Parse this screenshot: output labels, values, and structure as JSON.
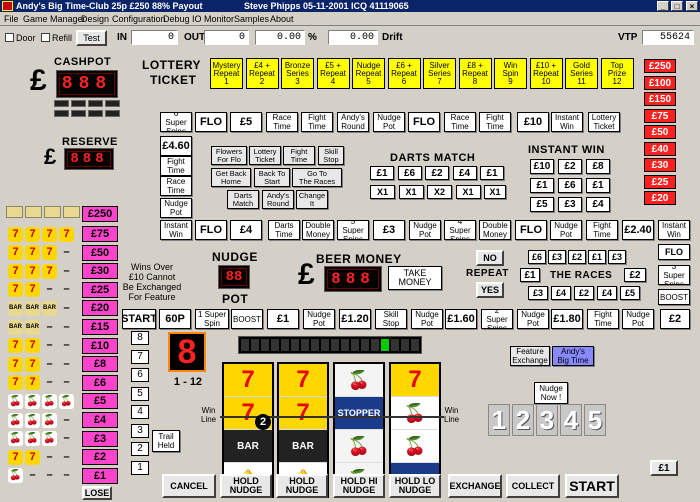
{
  "window": {
    "title": "Andy's Big Time-Club 25p £250 88% Payout",
    "titlebar_right": "Steve Phipps 05-11-2001 ICQ 41119065"
  },
  "menu": [
    "File",
    "Game Manager",
    "Design",
    "Configuration",
    "Debug",
    "IO Monitor",
    "Samples",
    "About"
  ],
  "toolbar": {
    "door_label": "Door",
    "refill_label": "Refill",
    "test_label": "Test",
    "in_label": "IN",
    "in_value": "0",
    "out_label": "OUT",
    "out_value": "0",
    "pct_value": "0.00",
    "pct_sign": "%",
    "drift_value": "0.00",
    "drift_label": "Drift",
    "vtp_label": "VTP",
    "vtp_value": "55624"
  },
  "cashpot": {
    "label": "CASHPOT",
    "currency": "£",
    "digits": "888"
  },
  "reserve": {
    "label": "RESERVE",
    "currency": "£",
    "digits": "888"
  },
  "lottery": {
    "title_line1": "LOTTERY",
    "title_line2": "TICKET",
    "tiles": [
      "Mystery\nRepeat\n1",
      "£4 +\nRepeat\n2",
      "Bronze\nSeries\n3",
      "£5 +\nRepeat\n4",
      "Nudge\nRepeat\n5",
      "£6 +\nRepeat\n6",
      "Silver\nSeries\n7",
      "£8 +\nRepeat\n8",
      "Win\nSpin\n9",
      "£10 +\nRepeat\n10",
      "Gold\nSeries\n11",
      "Top\nPrize\n12"
    ]
  },
  "right_ladder": [
    "£250",
    "£100",
    "£150",
    "£75",
    "£50",
    "£40",
    "£30",
    "£25",
    "£20"
  ],
  "left_ladder": [
    "£250",
    "£75",
    "£50",
    "£30",
    "£25",
    "£20",
    "£15",
    "£10",
    "£8",
    "£6",
    "£5",
    "£4",
    "£3",
    "£2",
    "£1"
  ],
  "lose_label": "LOSE",
  "trail_row1": [
    "6 Super\nSpins",
    "FLO",
    "£5",
    "Race\nTime",
    "Fight\nTime",
    "Andy's\nRound",
    "Nudge\nPot",
    "FLO",
    "Race\nTime",
    "Fight\nTime",
    "£10",
    "Instant\nWin",
    "Lottery\nTicket"
  ],
  "trail_left_col": [
    "£4.60",
    "Fight\nTime",
    "Race\nTime",
    "Nudge\nPot"
  ],
  "mini_grid": [
    "Flowers\nFor Flo",
    "Lottery\nTicket",
    "Fight\nTime",
    "Skill\nStop",
    "Get Back\nHome",
    "Back To\nStart",
    "Go To\nThe Races",
    "Darts\nMatch",
    "Andy's\nRound",
    "Change\nIt"
  ],
  "darts": {
    "label": "DARTS MATCH",
    "row1": [
      "£1",
      "£6",
      "£2",
      "£4",
      "£1"
    ],
    "row2": [
      "X1",
      "X1",
      "X2",
      "X1"
    ]
  },
  "instant_win": {
    "label": "INSTANT WIN",
    "row1": [
      "£10",
      "£2",
      "£8"
    ],
    "row2": [
      "£1",
      "£6",
      "£1"
    ],
    "row3": [
      "£5",
      "£3",
      "£4"
    ]
  },
  "trail_row2": [
    "Instant\nWin",
    "FLO",
    "£4",
    "Darts\nTime",
    "Double\nMoney",
    "5 Super\nSpins",
    "£3",
    "Nudge\nPot",
    "4 Super\nSpins",
    "Double\nMoney",
    "FLO",
    "Nudge\nPot",
    "Fight\nTime",
    "£2.40",
    "Instant\nWin"
  ],
  "right_col": [
    "FLO",
    "3 Super\nSpins",
    "BOOST"
  ],
  "wins_note": "Wins Over\n£10 Cannot\nBe Exchanged\nFor Feature",
  "nudge_pot": {
    "label_top": "NUDGE",
    "label_bottom": "POT",
    "digits": "88"
  },
  "beer_money": {
    "label": "BEER MONEY",
    "currency": "£",
    "digits": "888",
    "take_label": "TAKE\nMONEY"
  },
  "repeat": {
    "no_label": "NO",
    "label": "REPEAT",
    "yes_label": "YES"
  },
  "races": {
    "label": "THE RACES",
    "top": [
      "£6",
      "£3",
      "£2",
      "£1",
      "£3"
    ],
    "left": "£1",
    "right": "£2",
    "bottom": [
      "£3",
      "£4",
      "£2",
      "£4",
      "£5"
    ]
  },
  "trail_row3": [
    "START",
    "60P",
    "1 Super\nSpin",
    "BOOST",
    "£1",
    "Nudge\nPot",
    "£1.20",
    "Skill\nStop",
    "Nudge\nPot",
    "£1.60",
    "2 Super\nSpins",
    "Nudge\nPot",
    "£1.80",
    "Fight\nTime",
    "Nudge\nPot",
    "£2"
  ],
  "number_col": [
    "8",
    "7",
    "6",
    "5",
    "4",
    "3",
    "2",
    "1"
  ],
  "big_digit": "8",
  "range_label": "1 - 12",
  "trail_held": "Trail\nHeld",
  "win_line_left": "Win\nLine",
  "win_line_right": "Win\nLine",
  "reel_marker": "2",
  "reels": [
    [
      "7",
      "7",
      "BAR",
      "🔔"
    ],
    [
      "7",
      "7",
      "BAR",
      "🔔"
    ],
    [
      "🍒",
      "STOPPER",
      "🍒",
      "🍒"
    ],
    [
      "7",
      "🍒",
      "🍒",
      "LINK-UP"
    ]
  ],
  "feature_exchange": "Feature\nExchange",
  "andys_big_time": "Andy's\nBig Time",
  "nudge_now": "Nudge\nNow !",
  "nudge_digits": [
    "1",
    "2",
    "3",
    "4",
    "5"
  ],
  "credit_label": "£1",
  "bottom_buttons": [
    "CANCEL",
    "HOLD\nNUDGE",
    "HOLD\nNUDGE",
    "HOLD   HI\nNUDGE",
    "HOLD   LO\nNUDGE",
    "EXCHANGE",
    "COLLECT",
    "START"
  ],
  "colors": {
    "titlebar": "#0a246a",
    "lottery_yellow": "#ffff00",
    "ladder_red": "#ff2020",
    "ladder_magenta": "#ff44cc",
    "led_red": "#ff2222",
    "andys_big_time": "#8888ff"
  }
}
